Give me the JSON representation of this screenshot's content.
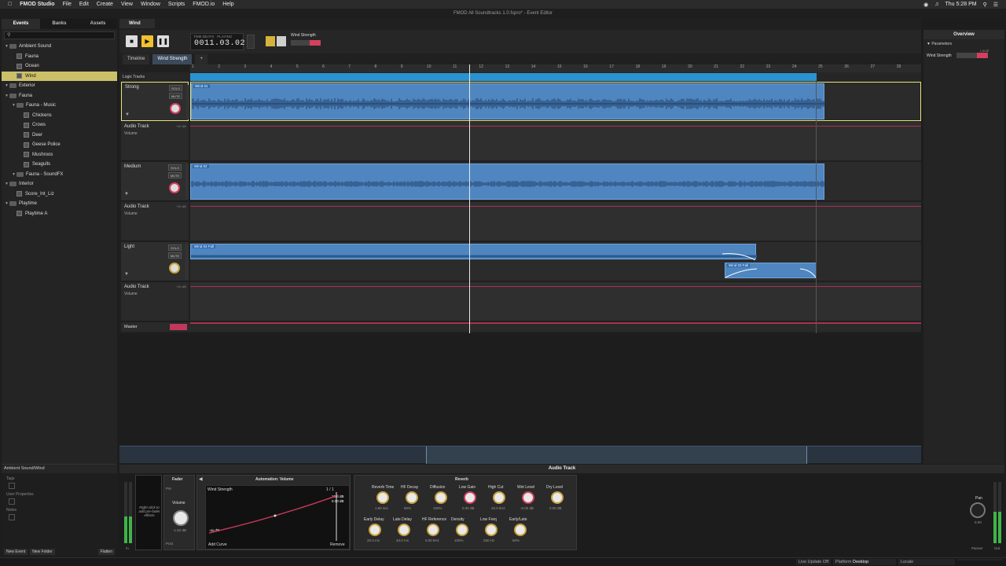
{
  "menubar": {
    "app": "FMOD Studio",
    "items": [
      "File",
      "Edit",
      "Create",
      "View",
      "Window",
      "Scripts",
      "FMOD.io",
      "Help"
    ],
    "clock": "Thu 5:28 PM"
  },
  "window_title": "FMOD All Soundtracks 1.0.fspro* - Event Editor",
  "browser": {
    "tabs": [
      "Events",
      "Banks",
      "Assets"
    ],
    "tree": [
      {
        "label": "Ambient Sound",
        "depth": 0,
        "kind": "folder"
      },
      {
        "label": "Fauna",
        "depth": 1,
        "kind": "event"
      },
      {
        "label": "Ocean",
        "depth": 1,
        "kind": "event"
      },
      {
        "label": "Wind",
        "depth": 1,
        "kind": "event",
        "selected": true
      },
      {
        "label": "Exterior",
        "depth": 0,
        "kind": "folder"
      },
      {
        "label": "Fauna",
        "depth": 0,
        "kind": "folder"
      },
      {
        "label": "Fauna - Music",
        "depth": 1,
        "kind": "folder"
      },
      {
        "label": "Chickens",
        "depth": 2,
        "kind": "event"
      },
      {
        "label": "Crows",
        "depth": 2,
        "kind": "event"
      },
      {
        "label": "Deer",
        "depth": 2,
        "kind": "event"
      },
      {
        "label": "Geese Police",
        "depth": 2,
        "kind": "event"
      },
      {
        "label": "Mushroos",
        "depth": 2,
        "kind": "event"
      },
      {
        "label": "Seagulls",
        "depth": 2,
        "kind": "event"
      },
      {
        "label": "Fauna - SoundFX",
        "depth": 1,
        "kind": "folder"
      },
      {
        "label": "Interior",
        "depth": 0,
        "kind": "folder"
      },
      {
        "label": "Score_Int_Liz",
        "depth": 1,
        "kind": "event"
      },
      {
        "label": "Playtime",
        "depth": 0,
        "kind": "folder"
      },
      {
        "label": "Playtime A",
        "depth": 1,
        "kind": "event"
      }
    ],
    "footer": {
      "path": "Ambient Sound/Wind",
      "labels": [
        "Tags",
        "User Properties",
        "Notes"
      ],
      "buttons": [
        "New Event",
        "New Folder",
        "Flatten"
      ]
    }
  },
  "editor": {
    "tab": "Wind",
    "time_labels": {
      "mode1": "TIME",
      "mode2": "BEATS",
      "state": "PLAYING"
    },
    "time": "0011.03.02",
    "param_label": "Wind Strength",
    "subtabs": [
      "Timeline",
      "Wind Strength",
      "+"
    ],
    "ruler": [
      "1",
      "2",
      "3",
      "4",
      "5",
      "6",
      "7",
      "8",
      "9",
      "10",
      "11",
      "12",
      "13",
      "14",
      "15",
      "16",
      "17",
      "18",
      "19",
      "20",
      "21",
      "22",
      "23",
      "24",
      "25",
      "26",
      "27",
      "28"
    ],
    "logic_tracks": "Logic Tracks",
    "tracks": [
      {
        "name": "Strong",
        "clip": "Wind 01",
        "sub": "Audio Track",
        "subparam": "Volume"
      },
      {
        "name": "Medium",
        "clip": "Wind 02",
        "sub": "Audio Track",
        "subparam": "Volume"
      },
      {
        "name": "Light",
        "clip": "Wind 03 Fall",
        "clip2": "Wind 03 Fall",
        "sub": "Audio Track",
        "subparam": "Volume"
      }
    ],
    "solo": "SOLO",
    "mute": "MUTE",
    "db_label": "+10 dB",
    "master": "Master"
  },
  "overview": {
    "title": "Overview",
    "section": "Parameters",
    "local": "Local",
    "param": "Wind Strength"
  },
  "deck": {
    "title": "Audio Track",
    "insert_hint": "Right click to add pre-fader effects",
    "fader_title": "Fader",
    "pre": "Pre",
    "post": "Post",
    "volume_label": "Volume",
    "volume_val": "-1.52 dB",
    "automation_title": "Automation: Volume",
    "automation_param": "Wind Strength",
    "automation_page": "1 / 1",
    "automation_val1": "10.0 dB",
    "automation_val2": "0.00 dB",
    "automation_low": "-oo dB",
    "add_curve": "Add Curve",
    "remove": "Remove",
    "reverb_title": "Reverb",
    "knobs_row1": [
      {
        "label": "Reverb Time",
        "value": "1.50 sec"
      },
      {
        "label": "HF Decay",
        "value": "50%"
      },
      {
        "label": "Diffusion",
        "value": "100%"
      },
      {
        "label": "Low Gain",
        "value": "0.00 dB"
      },
      {
        "label": "High Cut",
        "value": "20.0 kHz"
      },
      {
        "label": "Wet Level",
        "value": "-6.00 dB"
      },
      {
        "label": "Dry Level",
        "value": "0.00 dB"
      }
    ],
    "knobs_row2": [
      {
        "label": "Early Delay",
        "value": "20.0 ms"
      },
      {
        "label": "Late Delay",
        "value": "40.0 ms"
      },
      {
        "label": "HF Reference",
        "value": "5.00 kHz"
      },
      {
        "label": "Density",
        "value": "100%"
      },
      {
        "label": "Low Freq",
        "value": "250 Hz"
      },
      {
        "label": "Early/Late",
        "value": "50%"
      }
    ],
    "pan_label": "Pan",
    "pan_val": "0.00",
    "panner": "Panner",
    "out": "Out",
    "in": "In"
  },
  "status": {
    "live_update": "Live Update Off",
    "platform_label": "Platform",
    "platform": "Desktop",
    "locale": "Locale"
  }
}
